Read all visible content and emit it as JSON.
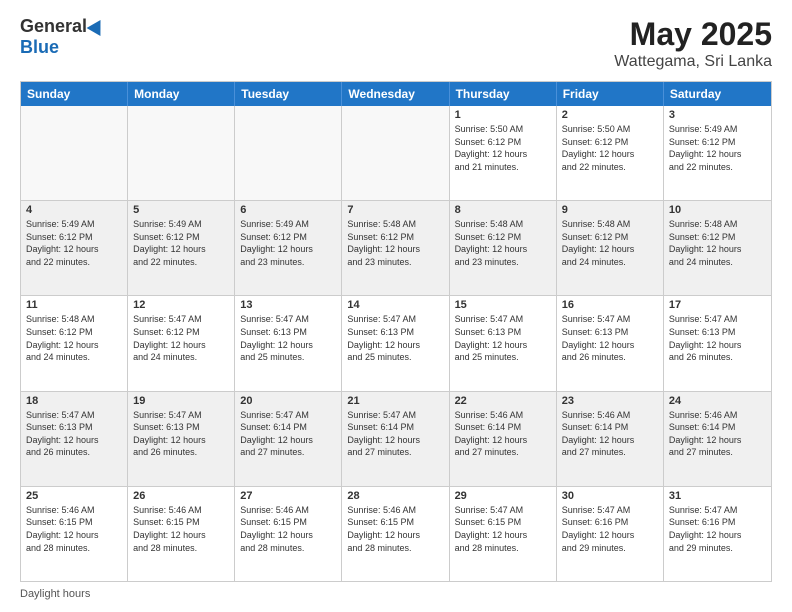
{
  "header": {
    "logo_general": "General",
    "logo_blue": "Blue",
    "title": "May 2025",
    "subtitle": "Wattegama, Sri Lanka"
  },
  "days": [
    "Sunday",
    "Monday",
    "Tuesday",
    "Wednesday",
    "Thursday",
    "Friday",
    "Saturday"
  ],
  "footer": "Daylight hours",
  "weeks": [
    [
      {
        "day": "",
        "empty": true
      },
      {
        "day": "",
        "empty": true
      },
      {
        "day": "",
        "empty": true
      },
      {
        "day": "",
        "empty": true
      },
      {
        "day": "1",
        "lines": [
          "Sunrise: 5:50 AM",
          "Sunset: 6:12 PM",
          "Daylight: 12 hours",
          "and 21 minutes."
        ]
      },
      {
        "day": "2",
        "lines": [
          "Sunrise: 5:50 AM",
          "Sunset: 6:12 PM",
          "Daylight: 12 hours",
          "and 22 minutes."
        ]
      },
      {
        "day": "3",
        "lines": [
          "Sunrise: 5:49 AM",
          "Sunset: 6:12 PM",
          "Daylight: 12 hours",
          "and 22 minutes."
        ]
      }
    ],
    [
      {
        "day": "4",
        "lines": [
          "Sunrise: 5:49 AM",
          "Sunset: 6:12 PM",
          "Daylight: 12 hours",
          "and 22 minutes."
        ]
      },
      {
        "day": "5",
        "lines": [
          "Sunrise: 5:49 AM",
          "Sunset: 6:12 PM",
          "Daylight: 12 hours",
          "and 22 minutes."
        ]
      },
      {
        "day": "6",
        "lines": [
          "Sunrise: 5:49 AM",
          "Sunset: 6:12 PM",
          "Daylight: 12 hours",
          "and 23 minutes."
        ]
      },
      {
        "day": "7",
        "lines": [
          "Sunrise: 5:48 AM",
          "Sunset: 6:12 PM",
          "Daylight: 12 hours",
          "and 23 minutes."
        ]
      },
      {
        "day": "8",
        "lines": [
          "Sunrise: 5:48 AM",
          "Sunset: 6:12 PM",
          "Daylight: 12 hours",
          "and 23 minutes."
        ]
      },
      {
        "day": "9",
        "lines": [
          "Sunrise: 5:48 AM",
          "Sunset: 6:12 PM",
          "Daylight: 12 hours",
          "and 24 minutes."
        ]
      },
      {
        "day": "10",
        "lines": [
          "Sunrise: 5:48 AM",
          "Sunset: 6:12 PM",
          "Daylight: 12 hours",
          "and 24 minutes."
        ]
      }
    ],
    [
      {
        "day": "11",
        "lines": [
          "Sunrise: 5:48 AM",
          "Sunset: 6:12 PM",
          "Daylight: 12 hours",
          "and 24 minutes."
        ]
      },
      {
        "day": "12",
        "lines": [
          "Sunrise: 5:47 AM",
          "Sunset: 6:12 PM",
          "Daylight: 12 hours",
          "and 24 minutes."
        ]
      },
      {
        "day": "13",
        "lines": [
          "Sunrise: 5:47 AM",
          "Sunset: 6:13 PM",
          "Daylight: 12 hours",
          "and 25 minutes."
        ]
      },
      {
        "day": "14",
        "lines": [
          "Sunrise: 5:47 AM",
          "Sunset: 6:13 PM",
          "Daylight: 12 hours",
          "and 25 minutes."
        ]
      },
      {
        "day": "15",
        "lines": [
          "Sunrise: 5:47 AM",
          "Sunset: 6:13 PM",
          "Daylight: 12 hours",
          "and 25 minutes."
        ]
      },
      {
        "day": "16",
        "lines": [
          "Sunrise: 5:47 AM",
          "Sunset: 6:13 PM",
          "Daylight: 12 hours",
          "and 26 minutes."
        ]
      },
      {
        "day": "17",
        "lines": [
          "Sunrise: 5:47 AM",
          "Sunset: 6:13 PM",
          "Daylight: 12 hours",
          "and 26 minutes."
        ]
      }
    ],
    [
      {
        "day": "18",
        "lines": [
          "Sunrise: 5:47 AM",
          "Sunset: 6:13 PM",
          "Daylight: 12 hours",
          "and 26 minutes."
        ]
      },
      {
        "day": "19",
        "lines": [
          "Sunrise: 5:47 AM",
          "Sunset: 6:13 PM",
          "Daylight: 12 hours",
          "and 26 minutes."
        ]
      },
      {
        "day": "20",
        "lines": [
          "Sunrise: 5:47 AM",
          "Sunset: 6:14 PM",
          "Daylight: 12 hours",
          "and 27 minutes."
        ]
      },
      {
        "day": "21",
        "lines": [
          "Sunrise: 5:47 AM",
          "Sunset: 6:14 PM",
          "Daylight: 12 hours",
          "and 27 minutes."
        ]
      },
      {
        "day": "22",
        "lines": [
          "Sunrise: 5:46 AM",
          "Sunset: 6:14 PM",
          "Daylight: 12 hours",
          "and 27 minutes."
        ]
      },
      {
        "day": "23",
        "lines": [
          "Sunrise: 5:46 AM",
          "Sunset: 6:14 PM",
          "Daylight: 12 hours",
          "and 27 minutes."
        ]
      },
      {
        "day": "24",
        "lines": [
          "Sunrise: 5:46 AM",
          "Sunset: 6:14 PM",
          "Daylight: 12 hours",
          "and 27 minutes."
        ]
      }
    ],
    [
      {
        "day": "25",
        "lines": [
          "Sunrise: 5:46 AM",
          "Sunset: 6:15 PM",
          "Daylight: 12 hours",
          "and 28 minutes."
        ]
      },
      {
        "day": "26",
        "lines": [
          "Sunrise: 5:46 AM",
          "Sunset: 6:15 PM",
          "Daylight: 12 hours",
          "and 28 minutes."
        ]
      },
      {
        "day": "27",
        "lines": [
          "Sunrise: 5:46 AM",
          "Sunset: 6:15 PM",
          "Daylight: 12 hours",
          "and 28 minutes."
        ]
      },
      {
        "day": "28",
        "lines": [
          "Sunrise: 5:46 AM",
          "Sunset: 6:15 PM",
          "Daylight: 12 hours",
          "and 28 minutes."
        ]
      },
      {
        "day": "29",
        "lines": [
          "Sunrise: 5:47 AM",
          "Sunset: 6:15 PM",
          "Daylight: 12 hours",
          "and 28 minutes."
        ]
      },
      {
        "day": "30",
        "lines": [
          "Sunrise: 5:47 AM",
          "Sunset: 6:16 PM",
          "Daylight: 12 hours",
          "and 29 minutes."
        ]
      },
      {
        "day": "31",
        "lines": [
          "Sunrise: 5:47 AM",
          "Sunset: 6:16 PM",
          "Daylight: 12 hours",
          "and 29 minutes."
        ]
      }
    ]
  ]
}
